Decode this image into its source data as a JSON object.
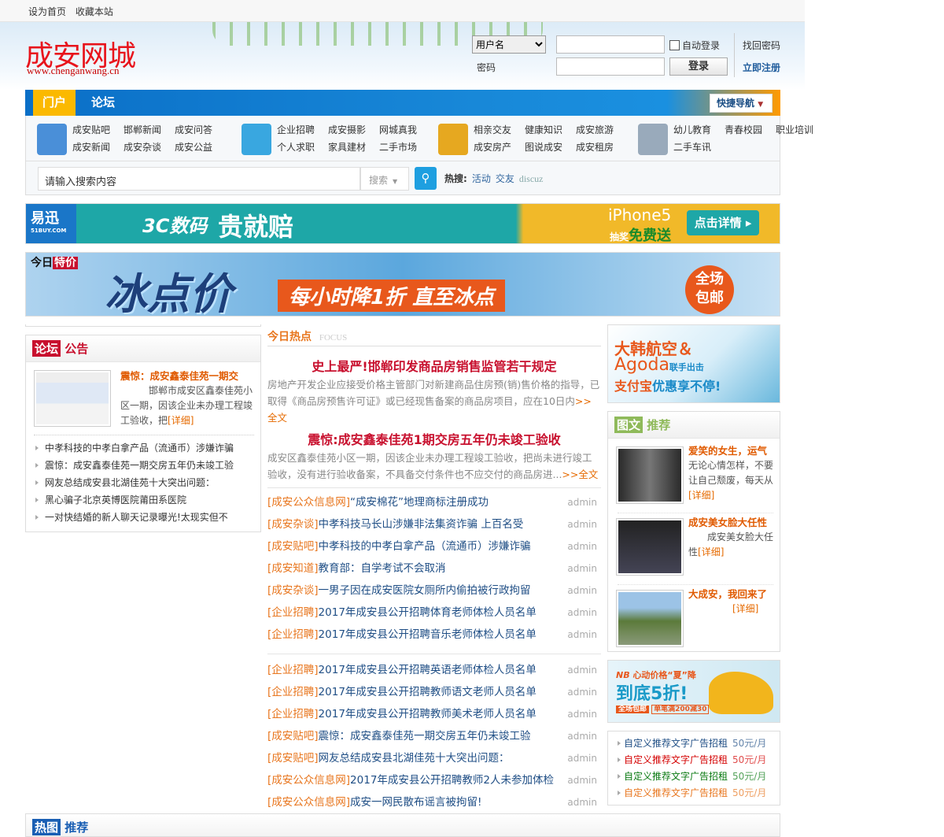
{
  "topbar": {
    "set_home": "设为首页",
    "bookmark": "收藏本站"
  },
  "header": {
    "logo": "成安网城",
    "logo_url": "www.chenganwang.cn",
    "login": {
      "username_option": "用户名",
      "password_label": "密码",
      "auto_login": "自动登录",
      "login_button": "登录",
      "forgot": "找回密码",
      "register": "立即注册"
    }
  },
  "nav": {
    "tabs": [
      {
        "label": "门户"
      },
      {
        "label": "论坛"
      }
    ],
    "quick_nav": "快捷导航"
  },
  "links": {
    "groups": [
      [
        "成安贴吧",
        "邯郸新闻",
        "成安问答",
        "成安新闻",
        "成安杂谈",
        "成安公益"
      ],
      [
        "企业招聘",
        "成安摄影",
        "网城真我",
        "个人求职",
        "家具建材",
        "二手市场"
      ],
      [
        "相亲交友",
        "健康知识",
        "成安旅游",
        "成安房产",
        "图说成安",
        "成安租房"
      ],
      [
        "幼儿教育",
        "青春校园",
        "职业培训",
        "二手车讯"
      ]
    ]
  },
  "search": {
    "placeholder": "请输入搜索内容",
    "type": "搜索",
    "hot_label": "热搜:",
    "hot": [
      "活动",
      "交友",
      "discuz"
    ]
  },
  "banners": {
    "b1": {
      "brand": "易迅",
      "brand_sub": "51BUY.COM",
      "slogan1": "3C数码",
      "slogan2": "贵就赔",
      "product": "iPhone5",
      "promo1": "抽奖",
      "promo2": "免费送",
      "cta": "点击详情 ▸"
    },
    "b2": {
      "tag1": "今日",
      "tag2": "特价",
      "big": "冰点价",
      "mid": "每小时降1折 直至冰点",
      "badge1": "全场",
      "badge2": "包邮"
    }
  },
  "left": {
    "head_tag": "论坛",
    "head": "公告",
    "feature": {
      "title": "震惊：成安鑫泰佳苑一期交",
      "summary": "邯郸市成安区鑫泰佳苑小区一期，因该企业未办理工程竣工验收，把",
      "more": "[详细]"
    },
    "items": [
      "中孝科技的中孝白拿产品（流通币）涉嫌诈骗",
      "震惊：成安鑫泰佳苑一期交房五年仍未竣工验",
      "网友总结成安县北湖佳苑十大突出问题：",
      "黑心骗子北京英博医院莆田系医院",
      "一对快结婚的新人聊天记录曝光!太现实但不"
    ]
  },
  "center": {
    "title": "今日热点",
    "subtitle": "FOCUS",
    "headlines": [
      {
        "title": "史上最严!邯郸印发商品房销售监管若干规定",
        "summary": "房地产开发企业应接受价格主管部门对新建商品住房预(销)售价格的指导，已取得《商品房预售许可证》或已经现售备案的商品房项目，应在10日内",
        "more": ">>全文"
      },
      {
        "title": "震惊:成安鑫泰佳苑1期交房五年仍未竣工验收",
        "summary": "成安区鑫泰佳苑小区一期，因该企业未办理工程竣工验收，把尚未进行竣工验收，没有进行验收备案，不具备交付条件也不应交付的商品房进...",
        "more": ">>全文"
      }
    ],
    "list1": [
      {
        "cat": "[成安公众信息网]",
        "title": "“成安棉花”地理商标注册成功",
        "author": "admin"
      },
      {
        "cat": "[成安杂谈]",
        "title": "中孝科技马长山涉嫌非法集资诈骗 上百名受",
        "author": "admin"
      },
      {
        "cat": "[成安贴吧]",
        "title": "中孝科技的中孝白拿产品（流通币）涉嫌诈骗",
        "author": "admin"
      },
      {
        "cat": "[成安知道]",
        "title": "教育部：自学考试不会取消",
        "author": "admin"
      },
      {
        "cat": "[成安杂谈]",
        "title": "一男子因在成安医院女厕所内偷拍被行政拘留",
        "author": "admin"
      },
      {
        "cat": "[企业招聘]",
        "title": "2017年成安县公开招聘体育老师体检人员名单",
        "author": "admin"
      },
      {
        "cat": "[企业招聘]",
        "title": "2017年成安县公开招聘音乐老师体检人员名单",
        "author": "admin"
      }
    ],
    "list2": [
      {
        "cat": "[企业招聘]",
        "title": "2017年成安县公开招聘英语老师体检人员名单",
        "author": "admin"
      },
      {
        "cat": "[企业招聘]",
        "title": "2017年成安县公开招聘教师语文老师人员名单",
        "author": "admin"
      },
      {
        "cat": "[企业招聘]",
        "title": "2017年成安县公开招聘教师美术老师人员名单",
        "author": "admin"
      },
      {
        "cat": "[成安贴吧]",
        "title": "震惊：成安鑫泰佳苑一期交房五年仍未竣工验",
        "author": "admin"
      },
      {
        "cat": "[成安贴吧]",
        "title": "网友总结成安县北湖佳苑十大突出问题：",
        "author": "admin"
      },
      {
        "cat": "[成安公众信息网]",
        "title": "2017年成安县公开招聘教师2人未参加体检",
        "author": "admin"
      },
      {
        "cat": "[成安公众信息网]",
        "title": "成安一网民散布谣言被拘留!",
        "author": "admin"
      }
    ]
  },
  "right": {
    "ad1": {
      "l1": "大韩航空＆",
      "l2": "Agoda",
      "l2b": "联手出击",
      "l3": "支付宝",
      "l3b": "优惠享不停!"
    },
    "pic_head_tag": "图文",
    "pic_head": "推荐",
    "pics": [
      {
        "title": "爱笑的女生，运气",
        "summary": "无论心情怎样，不要让自己颓废，每天从",
        "more": "[详细]"
      },
      {
        "title": "成安美女脸大任性",
        "summary": "成安美女脸大任性",
        "more": "[详细]"
      },
      {
        "title": "大成安，我回来了",
        "summary": "",
        "more": "[详细]"
      }
    ],
    "ad2": {
      "brand": "NB",
      "l1": "心动价格“夏”降",
      "l2": "到底5折!",
      "l3": "全场包邮",
      "l4": "单笔满200减30"
    },
    "text_ads": [
      {
        "text": "自定义推荐文字广告招租",
        "price": "50元/月",
        "color": "#1f4e85"
      },
      {
        "text": "自定义推荐文字广告招租",
        "price": "50元/月",
        "color": "#d40000"
      },
      {
        "text": "自定义推荐文字广告招租",
        "price": "50元/月",
        "color": "#0a7a12"
      },
      {
        "text": "自定义推荐文字广告招租",
        "price": "50元/月",
        "color": "#e8761e"
      }
    ]
  },
  "bottom": {
    "tag": "热图",
    "label": "推荐"
  }
}
